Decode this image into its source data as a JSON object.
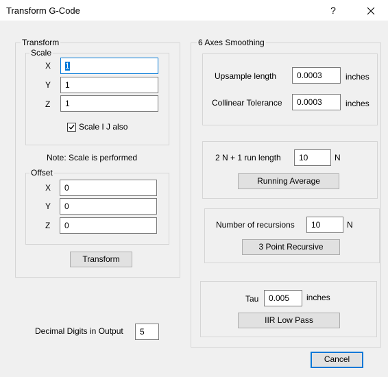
{
  "window": {
    "title": "Transform G-Code",
    "help_label": "?",
    "close_icon": "close-icon"
  },
  "transform": {
    "legend": "Transform",
    "scale": {
      "legend": "Scale",
      "x_label": "X",
      "x_value": "1",
      "y_label": "Y",
      "y_value": "1",
      "z_label": "Z",
      "z_value": "1",
      "checkbox_label": "Scale I J also",
      "checkbox_checked": true
    },
    "note": "Note: Scale is performed",
    "offset": {
      "legend": "Offset",
      "x_label": "X",
      "x_value": "0",
      "y_label": "Y",
      "y_value": "0",
      "z_label": "Z",
      "z_value": "0"
    },
    "button_label": "Transform"
  },
  "output": {
    "decimal_label": "Decimal Digits in Output",
    "decimal_value": "5"
  },
  "smoothing": {
    "legend": "6 Axes Smoothing",
    "upsample_label": "Upsample length",
    "upsample_value": "0.0003",
    "upsample_unit": "inches",
    "collinear_label": "Collinear Tolerance",
    "collinear_value": "0.0003",
    "collinear_unit": "inches",
    "run_length_label": "2 N + 1 run length",
    "run_length_value": "10",
    "run_length_unit": "N",
    "running_average_label": "Running Average",
    "recursions_label": "Number of recursions",
    "recursions_value": "10",
    "recursions_unit": "N",
    "recursive_label": "3 Point Recursive",
    "tau_label": "Tau",
    "tau_value": "0.005",
    "tau_unit": "inches",
    "iir_label": "IIR Low Pass"
  },
  "footer": {
    "cancel_label": "Cancel"
  }
}
